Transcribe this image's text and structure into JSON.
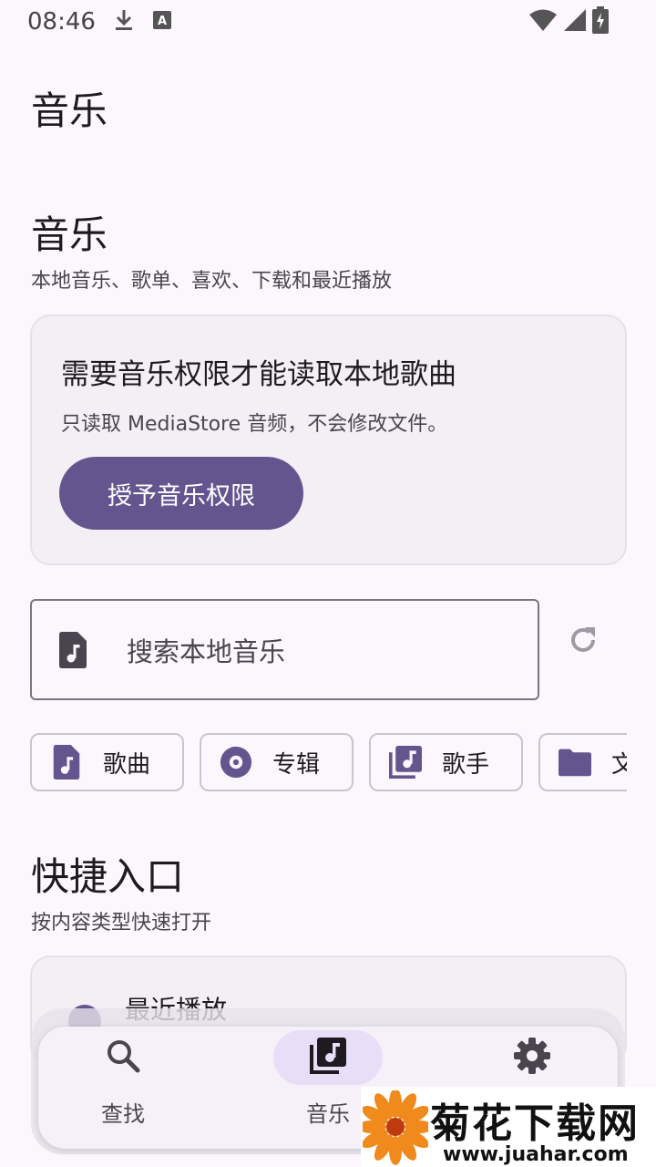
{
  "status_bar": {
    "time": "08:46",
    "icons": [
      "download-icon",
      "a-notification-icon",
      "wifi-icon",
      "signal-icon",
      "battery-charging-icon"
    ]
  },
  "app_bar": {
    "title": "音乐"
  },
  "music_section": {
    "title": "音乐",
    "subtitle": "本地音乐、歌单、喜欢、下载和最近播放"
  },
  "permission_card": {
    "title": "需要音乐权限才能读取本地歌曲",
    "description": "只读取 MediaStore 音频，不会修改文件。",
    "button_label": "授予音乐权限"
  },
  "search": {
    "placeholder": "搜索本地音乐",
    "leading_icon": "music-file-icon",
    "refresh_icon": "refresh-icon"
  },
  "chips": [
    {
      "label": "歌曲",
      "icon": "music-file-icon"
    },
    {
      "label": "专辑",
      "icon": "album-icon"
    },
    {
      "label": "歌手",
      "icon": "library-music-icon"
    },
    {
      "label": "文",
      "icon": "folder-icon"
    }
  ],
  "quick_section": {
    "title": "快捷入口",
    "subtitle": "按内容类型快速打开"
  },
  "quick_items": [
    {
      "label": "最近播放"
    }
  ],
  "bottom_nav": {
    "items": [
      {
        "label": "查找",
        "icon": "search-icon",
        "active": false
      },
      {
        "label": "音乐",
        "icon": "library-music-icon",
        "active": true
      },
      {
        "label": "",
        "icon": "gear-icon",
        "active": false
      }
    ]
  },
  "watermark": {
    "text": "菊花下载网",
    "url": "www.juahar.com"
  },
  "colors": {
    "background": "#fcf7fc",
    "primary": "#65558f",
    "active_indicator": "#e8def8"
  }
}
